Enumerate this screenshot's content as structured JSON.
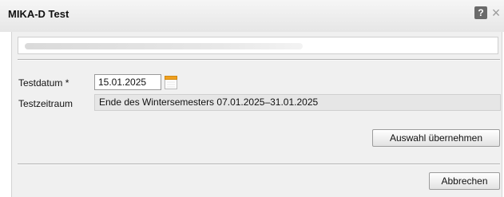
{
  "dialog": {
    "title": "MIKA-D Test",
    "help_glyph": "?",
    "close_glyph": "×"
  },
  "form": {
    "testdatum_label": "Testdatum *",
    "testdatum_value": "15.01.2025",
    "testzeitraum_label": "Testzeitraum",
    "testzeitraum_value": "Ende des Wintersemesters 07.01.2025–31.01.2025"
  },
  "buttons": {
    "apply_label": "Auswahl übernehmen",
    "cancel_label": "Abbrechen"
  },
  "icons": {
    "help": "help-icon",
    "close": "close-icon",
    "calendar": "calendar-icon"
  },
  "colors": {
    "calendar_accent": "#f0a020",
    "help_bg": "#6a6a6a"
  }
}
